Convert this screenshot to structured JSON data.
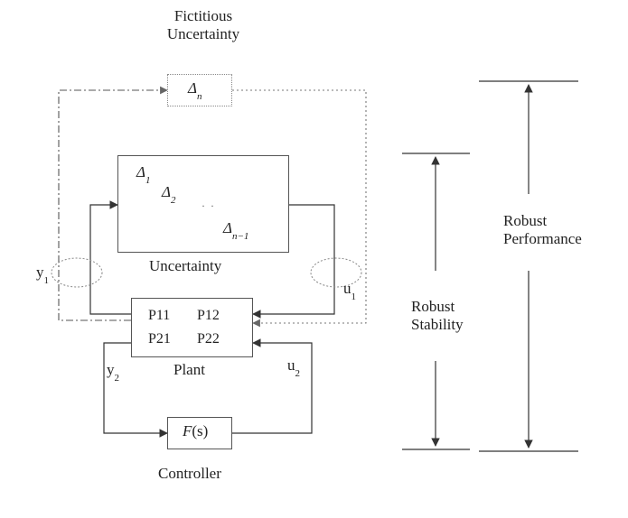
{
  "title_fictitious_l1": "Fictitious",
  "title_fictitious_l2": "Uncertainty",
  "delta_n": "Δ",
  "delta_n_sub": "n",
  "delta_1": "Δ",
  "delta_1_sub": "1",
  "delta_2": "Δ",
  "delta_2_sub": "2",
  "delta_nminus1": "Δ",
  "delta_nminus1_sub": "n−1",
  "uncertainty_label": "Uncertainty",
  "plant": {
    "p11": "P11",
    "p12": "P12",
    "p21": "P21",
    "p22": "P22"
  },
  "plant_label": "Plant",
  "controller_F": "F",
  "controller_s": "(s)",
  "controller_label": "Controller",
  "y1": "y",
  "y1_sub": "1",
  "u1": "u",
  "u1_sub": "1",
  "y2": "y",
  "y2_sub": "2",
  "u2": "u",
  "u2_sub": "2",
  "robust_stability": "Robust",
  "robust_stability_l2": "Stability",
  "robust_performance": "Robust",
  "robust_performance_l2": "Performance",
  "chart_data": {
    "type": "block-diagram",
    "blocks": [
      {
        "id": "FictitiousUncertainty",
        "symbol": "Δ_n",
        "style": "dotted"
      },
      {
        "id": "Uncertainty",
        "symbol": "diag(Δ_1, Δ_2, …, Δ_{n-1})"
      },
      {
        "id": "Plant",
        "matrix": [
          [
            "P11",
            "P12"
          ],
          [
            "P21",
            "P22"
          ]
        ]
      },
      {
        "id": "Controller",
        "symbol": "F(s)"
      }
    ],
    "signals": [
      "y1",
      "u1",
      "y2",
      "u2"
    ],
    "edges": [
      {
        "from": "Plant",
        "to": "Uncertainty",
        "via": "y1",
        "direction": "out-left-up-right"
      },
      {
        "from": "Uncertainty",
        "to": "Plant",
        "via": "u1",
        "direction": "out-right-down-left"
      },
      {
        "from": "Plant",
        "to": "FictitiousUncertainty",
        "via": "y1",
        "direction": "out-left-up-right",
        "style": "dashed"
      },
      {
        "from": "FictitiousUncertainty",
        "to": "Plant",
        "via": "u1",
        "direction": "out-right-down-left",
        "style": "dotted"
      },
      {
        "from": "Plant",
        "to": "Controller",
        "via": "y2",
        "direction": "out-left-down-right"
      },
      {
        "from": "Controller",
        "to": "Plant",
        "via": "u2",
        "direction": "out-right-up-left"
      }
    ],
    "annotations": [
      {
        "label": "Robust Stability",
        "spans_blocks": [
          "Uncertainty",
          "Plant",
          "Controller"
        ]
      },
      {
        "label": "Robust Performance",
        "spans_blocks": [
          "FictitiousUncertainty",
          "Uncertainty",
          "Plant",
          "Controller"
        ]
      }
    ]
  }
}
